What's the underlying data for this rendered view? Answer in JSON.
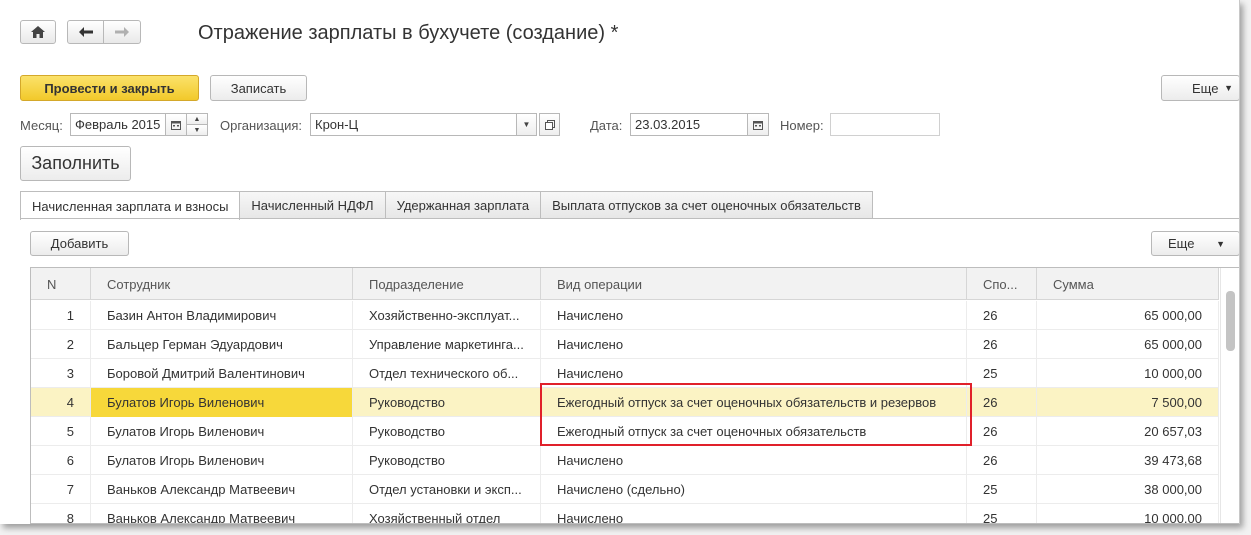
{
  "window": {
    "title": "Отражение зарплаты в бухучете (создание) *",
    "nav": {
      "home_icon": "home-icon",
      "back_icon": "arrow-left-icon",
      "forward_icon": "arrow-right-icon"
    }
  },
  "toolbar": {
    "post_close_label": "Провести и закрыть",
    "save_label": "Записать",
    "more_label": "Еще"
  },
  "form": {
    "month_label": "Месяц:",
    "month_value": "Февраль 2015",
    "org_label": "Организация:",
    "org_value": "Крон-Ц",
    "date_label": "Дата:",
    "date_value": "23.03.2015",
    "number_label": "Номер:",
    "number_value": ""
  },
  "fill_label": "Заполнить",
  "tabs": [
    {
      "label": "Начисленная зарплата и взносы",
      "active": true
    },
    {
      "label": "Начисленный НДФЛ"
    },
    {
      "label": "Удержанная зарплата"
    },
    {
      "label": "Выплата отпусков за счет оценочных обязательств"
    }
  ],
  "table_toolbar": {
    "add_label": "Добавить",
    "more_label": "Еще"
  },
  "table": {
    "columns": [
      "N",
      "Сотрудник",
      "Подразделение",
      "Вид операции",
      "Спо...",
      "Сумма"
    ],
    "rows": [
      {
        "n": "1",
        "employee": "Базин Антон Владимирович",
        "dept": "Хозяйственно-эксплуат...",
        "operation": "Начислено",
        "code": "26",
        "sum": "65 000,00"
      },
      {
        "n": "2",
        "employee": "Бальцер Герман Эдуардович",
        "dept": "Управление маркетинга...",
        "operation": "Начислено",
        "code": "26",
        "sum": "65 000,00"
      },
      {
        "n": "3",
        "employee": "Боровой Дмитрий Валентинович",
        "dept": "Отдел технического об...",
        "operation": "Начислено",
        "code": "25",
        "sum": "10 000,00"
      },
      {
        "n": "4",
        "employee": "Булатов Игорь Виленович",
        "dept": "Руководство",
        "operation": "Ежегодный отпуск за счет оценочных обязательств и резервов",
        "code": "26",
        "sum": "7 500,00",
        "selected": true
      },
      {
        "n": "5",
        "employee": "Булатов Игорь Виленович",
        "dept": "Руководство",
        "operation": "Ежегодный отпуск за счет оценочных обязательств",
        "code": "26",
        "sum": "20 657,03"
      },
      {
        "n": "6",
        "employee": "Булатов Игорь Виленович",
        "dept": "Руководство",
        "operation": "Начислено",
        "code": "26",
        "sum": "39 473,68"
      },
      {
        "n": "7",
        "employee": "Ваньков Александр Матвеевич",
        "dept": "Отдел установки и эксп...",
        "operation": "Начислено (сдельно)",
        "code": "25",
        "sum": "38 000,00"
      },
      {
        "n": "8",
        "employee": "Ваньков Александр Матвеевич",
        "dept": "Хозяйственный отдел",
        "operation": "Начислено",
        "code": "25",
        "sum": "10 000,00"
      }
    ]
  },
  "colors": {
    "primary_button": "#f2c92a",
    "selected_row": "#fbf3c4",
    "selected_cell": "#f7d83a",
    "highlight_box": "#e0202a"
  }
}
